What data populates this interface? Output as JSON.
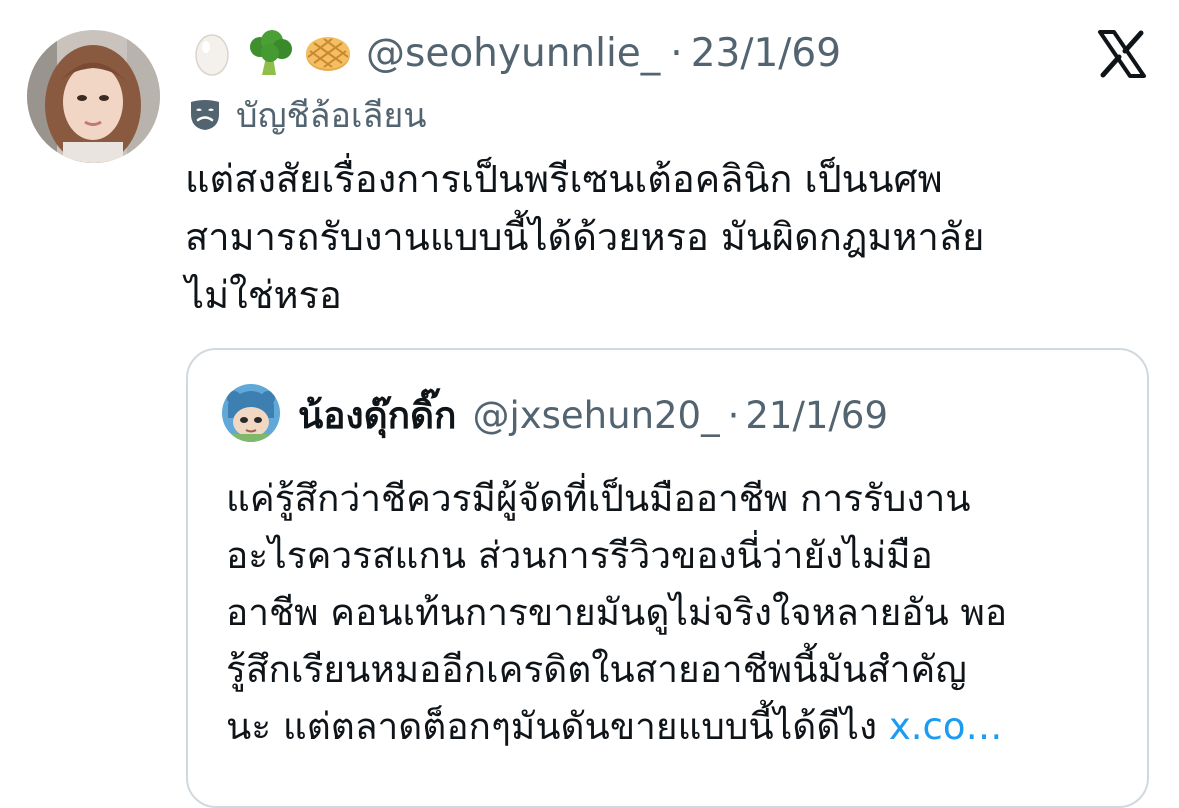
{
  "tweet": {
    "handle": "@seohyunnlie_",
    "separator": "·",
    "date": "23/1/69",
    "name_emojis": [
      "egg-emoji",
      "broccoli-emoji",
      "waffle-emoji"
    ],
    "parody_label": "บัญชีล้อเลียน",
    "text_lines": [
      "แต่สงสัยเรื่องการเป็นพรีเซนเต้อคลินิก เป็นนศพ",
      "สามารถรับงานแบบนี้ได้ด้วยหรอ มันผิดกฎมหาลัย",
      "ไม่ใช่หรอ"
    ]
  },
  "quoted": {
    "name": "น้องดุ๊กดิ๊ก",
    "handle": "@jxsehun20_",
    "separator": "·",
    "date": "21/1/69",
    "text_lines": [
      "แค่รู้สึกว่าชีควรมีผู้จัดที่เป็นมืออาชีพ การรับงาน",
      "อะไรควรสแกน ส่วนการรีวิวของนี่ว่ายังไม่มือ",
      "อาชีพ คอนเท้นการขายมันดูไม่จริงใจหลายอัน พอ",
      "รู้สึกเรียนหมออีกเครดิตในสายอาชีพนี้มันสำคัญ",
      "นะ แต่ตลาดต็อกๆมันดันขายแบบนี้ได้ดีไง"
    ],
    "link_text": "x.co…"
  },
  "icons": {
    "platform_logo": "x-logo",
    "parody": "mask-icon"
  },
  "colors": {
    "text_primary": "#0f1419",
    "text_secondary": "#536471",
    "link": "#1d9bf0",
    "border": "#cfd9de"
  }
}
